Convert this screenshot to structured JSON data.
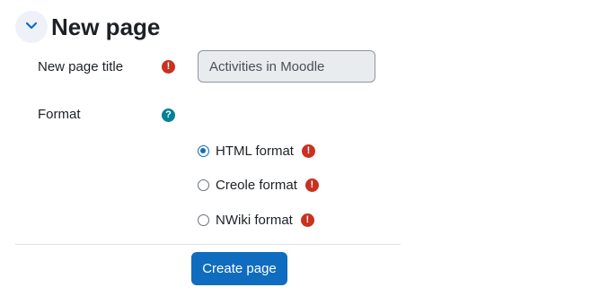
{
  "section": {
    "title": "New page",
    "toggle_icon": "chevron-down-icon"
  },
  "form": {
    "title_label": "New page title",
    "title_value": "Activities in Moodle",
    "format_label": "Format",
    "required_icon": "!",
    "help_icon": "?",
    "formats": [
      {
        "label": "HTML format",
        "checked": true
      },
      {
        "label": "Creole format",
        "checked": false
      },
      {
        "label": "NWiki format",
        "checked": false
      }
    ],
    "submit_label": "Create page"
  },
  "colors": {
    "accent": "#0f6cbf",
    "required": "#ca3120",
    "help": "#008196"
  }
}
